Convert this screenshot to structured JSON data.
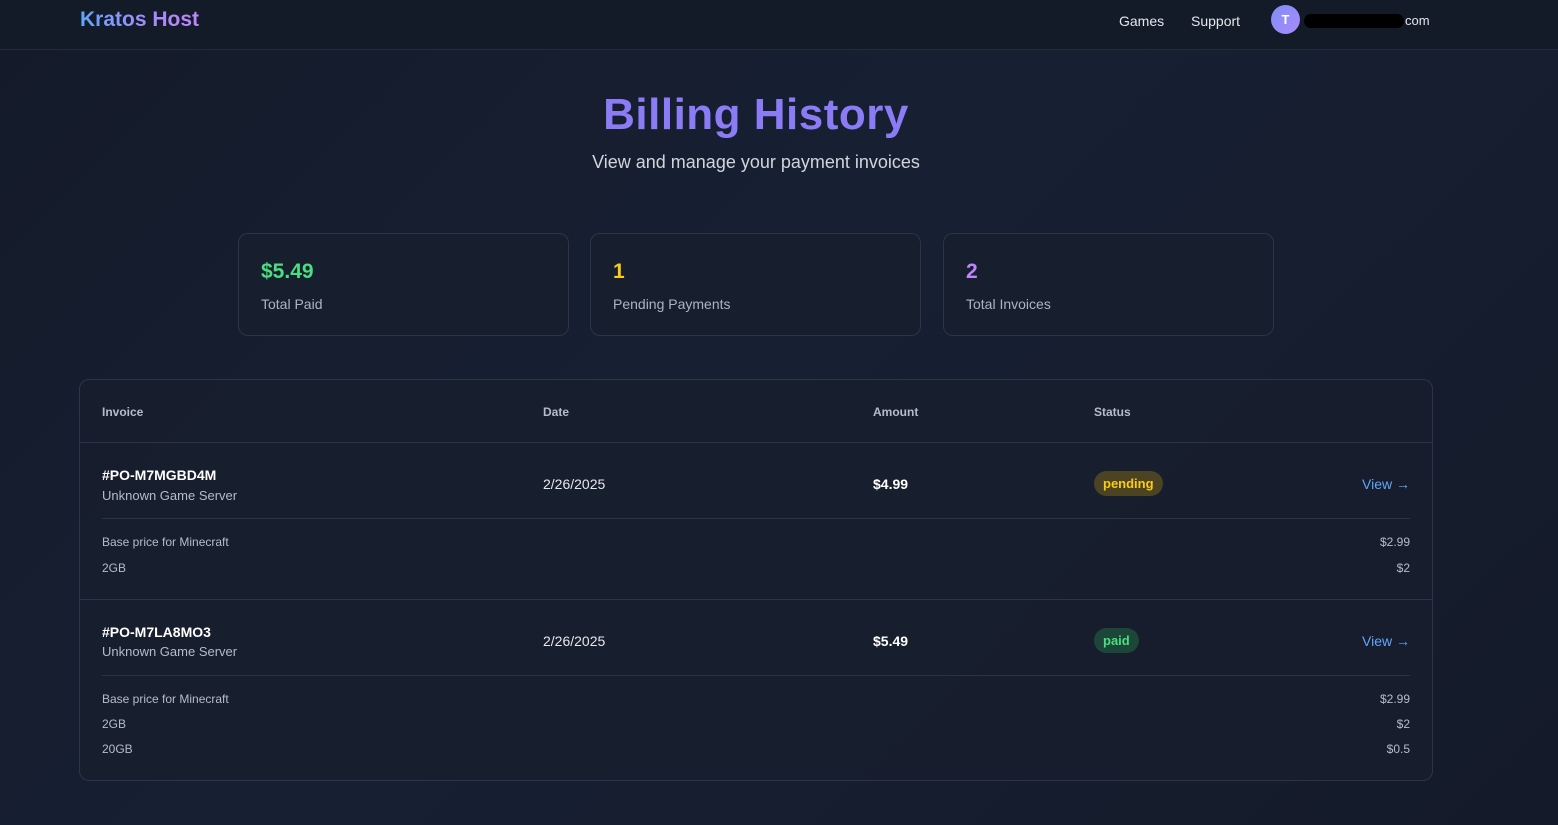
{
  "nav": {
    "brand": "Kratos Host",
    "links": [
      "Games",
      "Support"
    ],
    "avatar_initial": "T",
    "email_visible_suffix": "com"
  },
  "header": {
    "title": "Billing History",
    "subtitle": "View and manage your payment invoices"
  },
  "stats": [
    {
      "value": "$5.49",
      "label": "Total Paid",
      "color": "#4ade80"
    },
    {
      "value": "1",
      "label": "Pending Payments",
      "color": "#facc15"
    },
    {
      "value": "2",
      "label": "Total Invoices",
      "color": "#c084fc"
    }
  ],
  "table": {
    "columns": [
      "Invoice",
      "Date",
      "Amount",
      "Status"
    ],
    "rows": [
      {
        "id": "#PO-M7MGBD4M",
        "server": "Unknown Game Server",
        "date": "2/26/2025",
        "amount": "$4.99",
        "status": "pending",
        "view_label": "View →",
        "items": [
          {
            "label": "Base price for Minecraft",
            "price": "$2.99"
          },
          {
            "label": "2GB",
            "price": "$2"
          }
        ]
      },
      {
        "id": "#PO-M7LA8MO3",
        "server": "Unknown Game Server",
        "date": "2/26/2025",
        "amount": "$5.49",
        "status": "paid",
        "view_label": "View →",
        "items": [
          {
            "label": "Base price for Minecraft",
            "price": "$2.99"
          },
          {
            "label": "2GB",
            "price": "$2"
          },
          {
            "label": "20GB",
            "price": "$0.5"
          }
        ]
      }
    ]
  },
  "colors": {
    "accent": "#8b7cf6",
    "link": "#60a5fa",
    "pending": "#facc15",
    "paid": "#4ade80"
  }
}
